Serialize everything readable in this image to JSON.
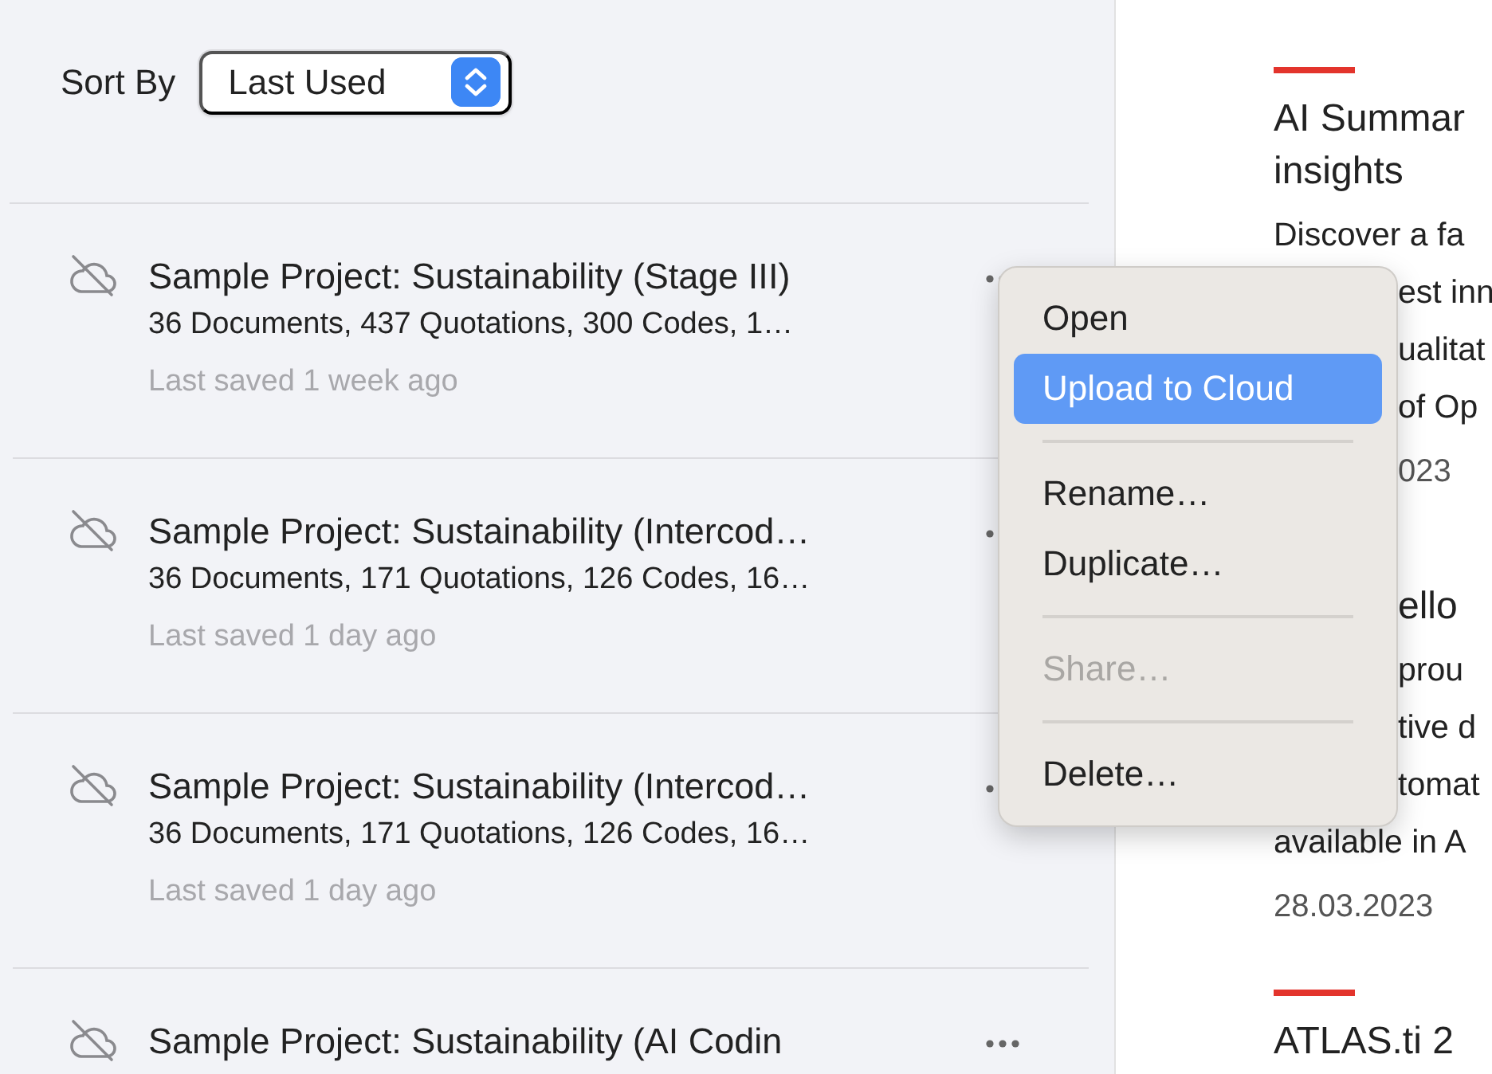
{
  "sort": {
    "label": "Sort By",
    "value": "Last Used"
  },
  "projects": [
    {
      "title": "Sample Project: Sustainability (Stage III)",
      "details": "36 Documents, 437 Quotations, 300 Codes, 1…",
      "saved": "Last saved 1 week ago"
    },
    {
      "title": "Sample Project: Sustainability (Intercod…",
      "details": "36 Documents, 171 Quotations, 126 Codes, 16…",
      "saved": "Last saved 1 day ago"
    },
    {
      "title": "Sample Project: Sustainability (Intercod…",
      "details": "36 Documents, 171 Quotations, 126 Codes, 16…",
      "saved": "Last saved 1 day ago"
    },
    {
      "title": "Sample Project: Sustainability (AI Codin"
    }
  ],
  "context_menu": [
    {
      "kind": "item",
      "label": "Open",
      "selected": false,
      "disabled": false
    },
    {
      "kind": "item",
      "label": "Upload to Cloud",
      "selected": true,
      "disabled": false
    },
    {
      "kind": "separator"
    },
    {
      "kind": "item",
      "label": "Rename…",
      "selected": false,
      "disabled": false
    },
    {
      "kind": "item",
      "label": "Duplicate…",
      "selected": false,
      "disabled": false
    },
    {
      "kind": "separator"
    },
    {
      "kind": "item",
      "label": "Share…",
      "selected": false,
      "disabled": true
    },
    {
      "kind": "separator"
    },
    {
      "kind": "item",
      "label": "Delete…",
      "selected": false,
      "disabled": false
    }
  ],
  "news": [
    {
      "title_lines": [
        {
          "text": "AI Summar",
          "covered": false
        },
        {
          "text": "insights",
          "covered": false
        }
      ],
      "body_lines": [
        {
          "text": "Discover a fa",
          "covered": false
        },
        {
          "text": "est inn",
          "covered": true
        },
        {
          "text": "ualitat",
          "covered": true
        },
        {
          "text": "of Op",
          "covered": true
        }
      ],
      "date": {
        "text": "023",
        "covered": true
      }
    },
    {
      "title_lines": [
        {
          "text": "ello",
          "covered": true
        }
      ],
      "body_lines": [
        {
          "text": "prou",
          "covered": true
        },
        {
          "text": "tive d",
          "covered": true
        },
        {
          "text": "tomat",
          "covered": true
        },
        {
          "text": "available in A",
          "covered": false
        }
      ],
      "date": {
        "text": "28.03.2023",
        "covered": false
      }
    },
    {
      "title_lines": [
        {
          "text": "ATLAS.ti 2",
          "covered": false
        }
      ]
    }
  ]
}
